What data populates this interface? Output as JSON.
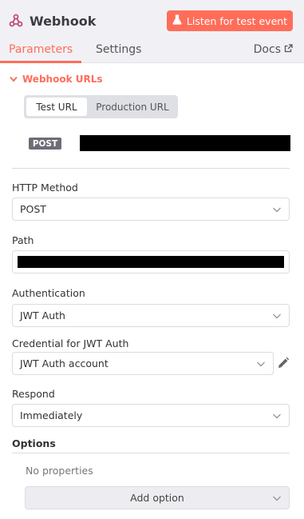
{
  "node": {
    "title": "Webhook",
    "icon": "webhook-icon",
    "listen_button": "Listen for test event",
    "listen_icon": "flask-icon"
  },
  "tabs": [
    {
      "label": "Parameters",
      "active": true
    },
    {
      "label": "Settings",
      "active": false
    }
  ],
  "docs": {
    "label": "Docs",
    "icon": "external-link-icon"
  },
  "webhook_urls": {
    "title": "Webhook URLs",
    "options": [
      "Test URL",
      "Production URL"
    ],
    "selected": "Test URL",
    "method": "POST"
  },
  "fields": {
    "http_method": {
      "label": "HTTP Method",
      "value": "POST"
    },
    "path": {
      "label": "Path"
    },
    "authentication": {
      "label": "Authentication",
      "value": "JWT Auth"
    },
    "credential": {
      "label": "Credential for JWT Auth",
      "value": "JWT Auth account"
    },
    "respond": {
      "label": "Respond",
      "value": "Immediately"
    }
  },
  "options": {
    "title": "Options",
    "empty_text": "No properties",
    "add_button": "Add option"
  },
  "colors": {
    "accent": "#ff6d5a",
    "badge": "#6d6d78",
    "border": "#dcdce1"
  }
}
